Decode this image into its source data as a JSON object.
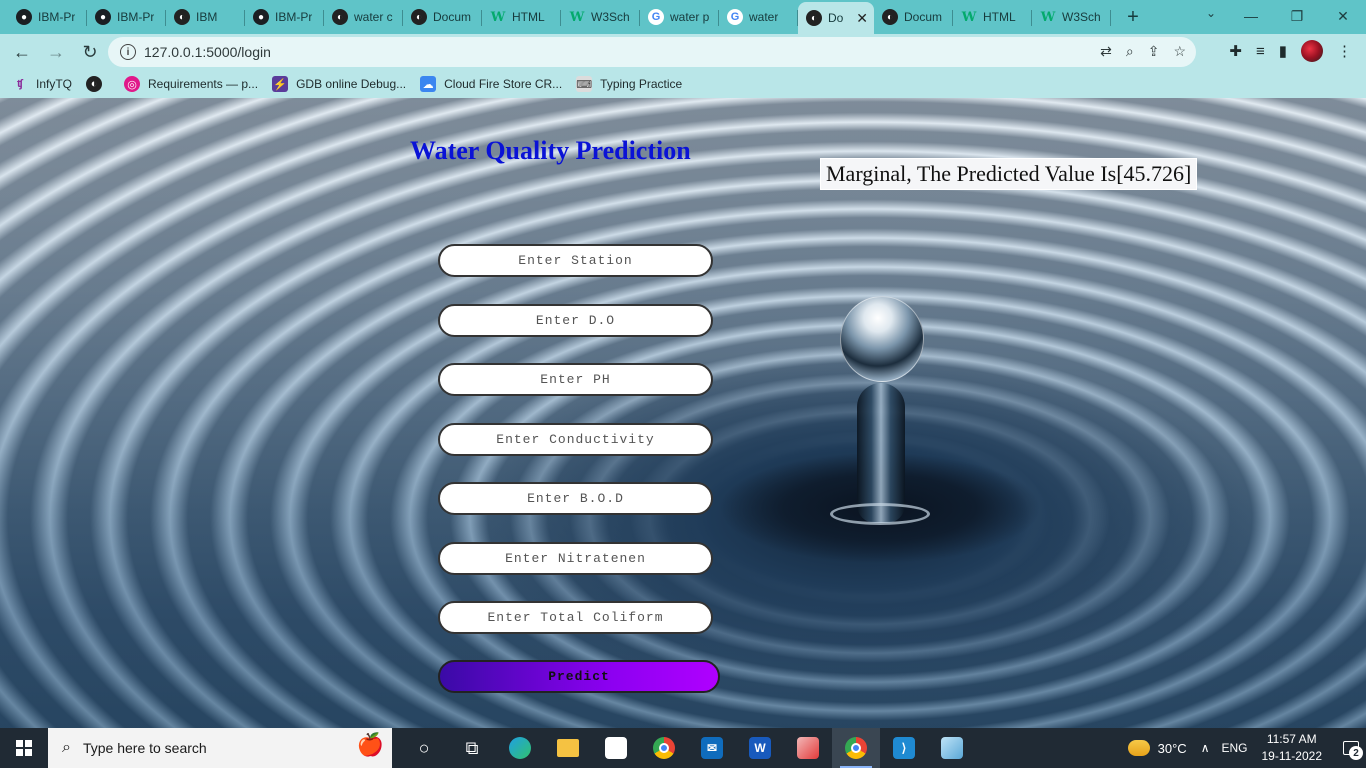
{
  "browser": {
    "tabs": [
      {
        "label": "IBM-Pr",
        "icon": "github-icon"
      },
      {
        "label": "IBM-Pr",
        "icon": "github-icon"
      },
      {
        "label": "IBM",
        "icon": "globe-icon"
      },
      {
        "label": "IBM-Pr",
        "icon": "github-icon"
      },
      {
        "label": "water c",
        "icon": "globe-icon"
      },
      {
        "label": "Docum",
        "icon": "globe-icon"
      },
      {
        "label": "HTML",
        "icon": "w3schools-icon"
      },
      {
        "label": "W3Sch",
        "icon": "w3schools-icon"
      },
      {
        "label": "water p",
        "icon": "google-icon"
      },
      {
        "label": "water",
        "icon": "google-icon"
      },
      {
        "label": "Do",
        "icon": "globe-icon",
        "active": true
      },
      {
        "label": "Docum",
        "icon": "globe-icon"
      },
      {
        "label": "HTML",
        "icon": "w3schools-icon"
      },
      {
        "label": "W3Sch",
        "icon": "w3schools-icon"
      }
    ],
    "url": "127.0.0.1:5000/login",
    "bookmarks": [
      {
        "label": "InfyTQ",
        "icon": "infytq-icon"
      },
      {
        "label": "",
        "icon": "globe-icon"
      },
      {
        "label": "Requirements — p...",
        "icon": "requirements-icon"
      },
      {
        "label": "GDB online Debug...",
        "icon": "gdb-icon"
      },
      {
        "label": "Cloud Fire Store CR...",
        "icon": "cloud-icon"
      },
      {
        "label": "Typing Practice",
        "icon": "typing-icon"
      }
    ]
  },
  "page": {
    "title": "Water Quality Prediction",
    "result": "Marginal, The Predicted Value Is[45.726]",
    "fields": {
      "station": "Enter Station",
      "do": "Enter D.O",
      "ph": "Enter PH",
      "conductivity": "Enter Conductivity",
      "bod": "Enter B.O.D",
      "nitrate": "Enter Nitratenen",
      "coliform": "Enter Total Coliform"
    },
    "predict_label": "Predict",
    "colors": {
      "title": "#0a12d6",
      "predict_start": "#3a0aa6",
      "predict_end": "#b000ff"
    }
  },
  "taskbar": {
    "search_placeholder": "Type here to search",
    "temperature": "30°C",
    "language": "ENG",
    "time": "11:57 AM",
    "date": "19-11-2022",
    "notifications": "2"
  }
}
